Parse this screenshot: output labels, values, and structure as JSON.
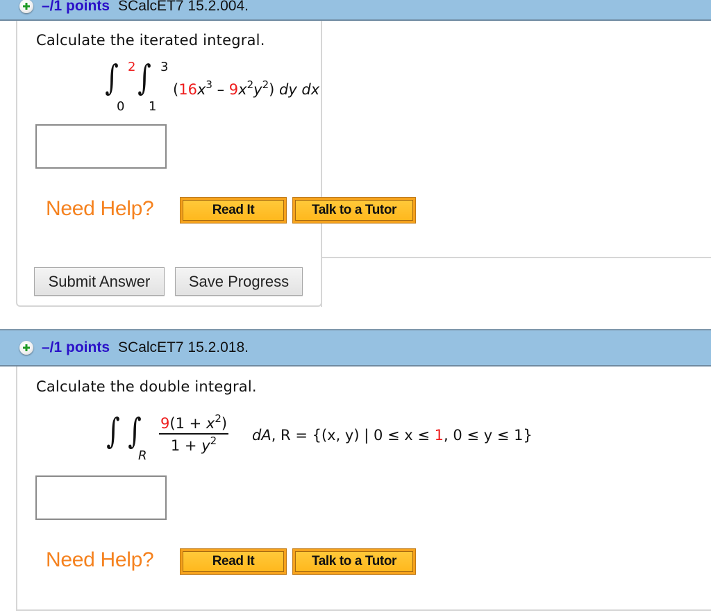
{
  "questions": [
    {
      "header": {
        "points": "–/1 points",
        "code": "SCalcET7 15.2.004."
      },
      "prompt": "Calculate the iterated integral.",
      "math": {
        "outer_upper": "2",
        "outer_lower": "0",
        "inner_upper": "3",
        "inner_lower": "1",
        "open_paren": "(",
        "coef1": "16",
        "var1": "x",
        "exp1": "3",
        "minus": " – ",
        "coef2": "9",
        "var2a": "x",
        "exp2a": "2",
        "var2b": "y",
        "exp2b": "2",
        "close_paren": ")",
        "differentials": " dy dx"
      },
      "answer": {
        "value": "",
        "placeholder": ""
      },
      "help": {
        "label": "Need Help?",
        "read_it": "Read It",
        "tutor": "Talk to a Tutor"
      },
      "buttons": {
        "submit": "Submit Answer",
        "save": "Save Progress"
      }
    },
    {
      "header": {
        "points": "–/1 points",
        "code": "SCalcET7 15.2.018."
      },
      "prompt": "Calculate the double integral.",
      "math": {
        "region_sub": "R",
        "num_coef": "9",
        "num_rest_a": "(1 + ",
        "num_var": "x",
        "num_exp": "2",
        "num_rest_b": ")",
        "den_a": "1 + ",
        "den_var": "y",
        "den_exp": "2",
        "dA": "dA",
        "region_def_a": ", R = {(x, y) | 0 ≤ x ≤ ",
        "x_upper": "1",
        "region_def_b": ", 0 ≤ y ≤ 1}"
      },
      "answer": {
        "value": "",
        "placeholder": ""
      },
      "help": {
        "label": "Need Help?",
        "read_it": "Read It",
        "tutor": "Talk to a Tutor"
      }
    }
  ],
  "colors": {
    "header_bg": "#96c1e1",
    "points_text": "#2a10c8",
    "need_help": "#f5821f",
    "help_button": "#ffb81e",
    "random_param_red": "#ee1c1c",
    "plus_icon_green": "#1f9a26"
  }
}
